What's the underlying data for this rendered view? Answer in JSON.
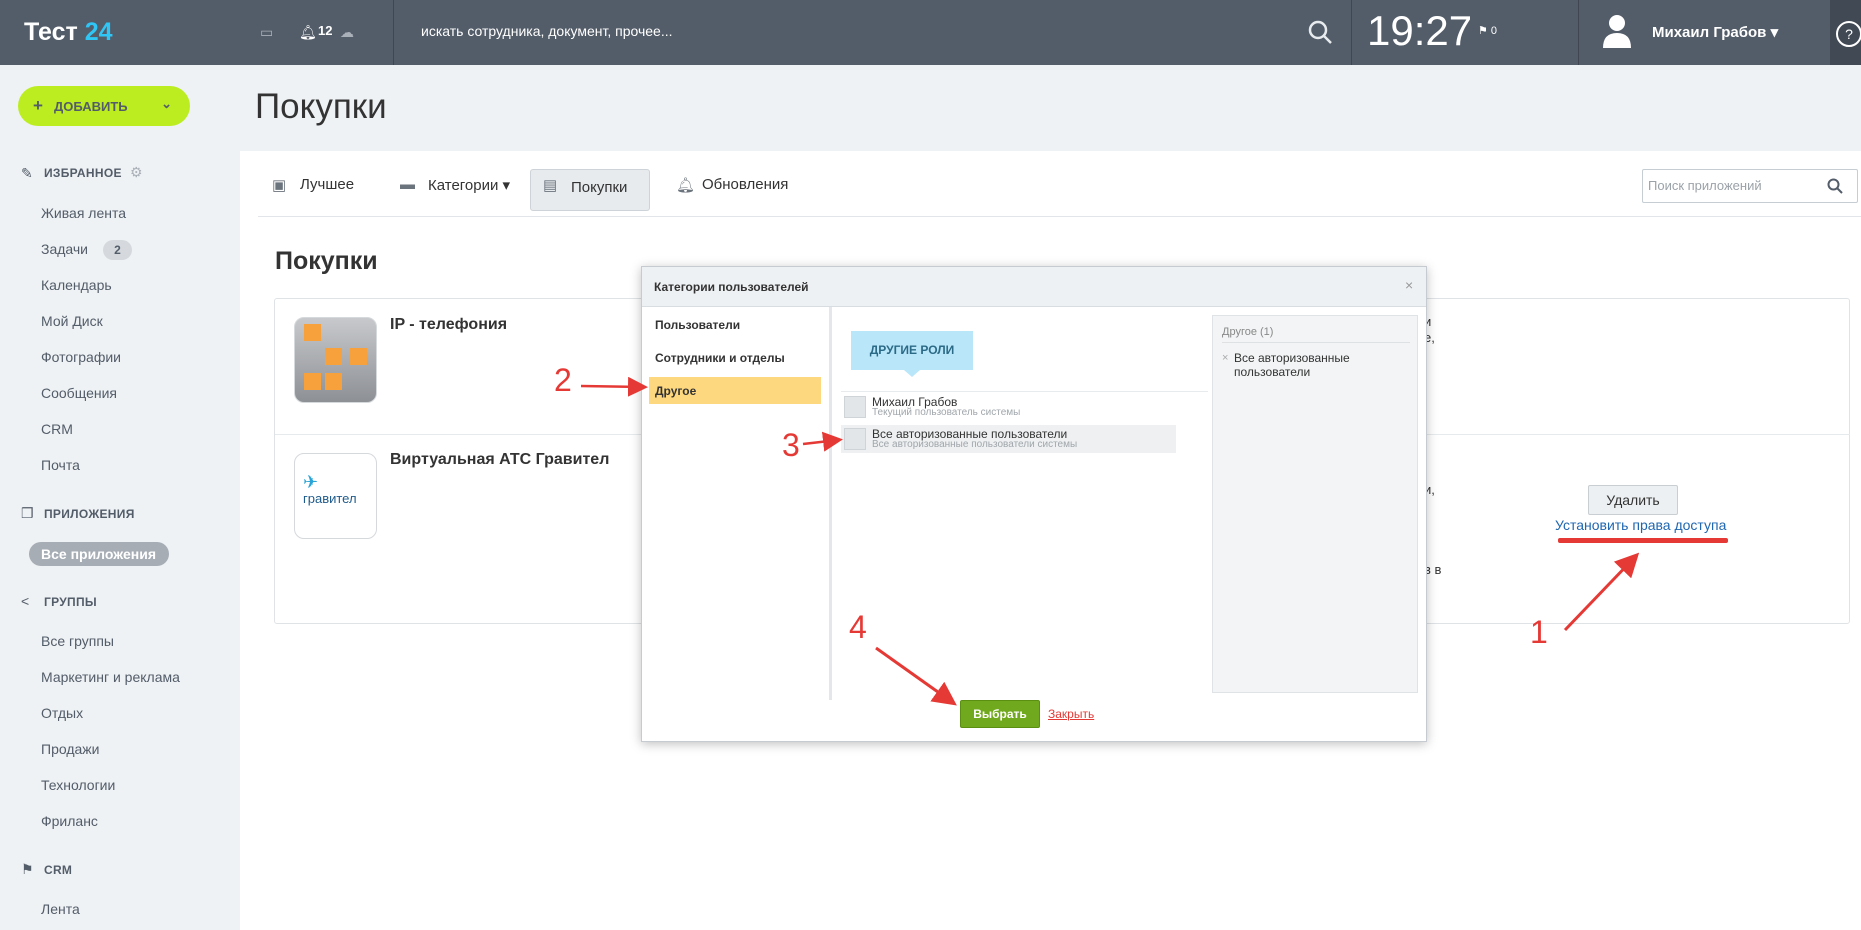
{
  "header": {
    "logo_text": "Тест ",
    "logo_num": "24",
    "notif_count": "12",
    "search_placeholder": "искать сотрудника, документ, прочее...",
    "clock": "19:27",
    "flag_count": "0",
    "user_name": "Михаил Грабов ▾",
    "help": "?"
  },
  "sidebar": {
    "add_label": "ДОБАВИТЬ",
    "favorites_title": "ИЗБРАННОЕ",
    "favorites": [
      "Живая лента",
      "Задачи",
      "Календарь",
      "Мой Диск",
      "Фотографии",
      "Сообщения",
      "CRM",
      "Почта"
    ],
    "tasks_badge": "2",
    "apps_title": "ПРИЛОЖЕНИЯ",
    "apps_active": "Все приложения",
    "groups_title": "ГРУППЫ",
    "groups": [
      "Все группы",
      "Маркетинг и реклама",
      "Отдых",
      "Продажи",
      "Технологии",
      "Фриланс"
    ],
    "crm_title": "CRM",
    "crm_items": [
      "Лента"
    ]
  },
  "page": {
    "title": "Покупки",
    "section_title": "Покупки",
    "tabs": [
      "Лучшее",
      "Категории ▾",
      "Покупки",
      "Обновления"
    ],
    "app_search_placeholder": "Поиск приложений"
  },
  "apps": [
    {
      "name": "IP - телефония",
      "fragments": [
        "и",
        "е,"
      ]
    },
    {
      "name": "Виртуальная АТС Гравител",
      "logo_text": "гравител",
      "fragments": [
        "и,",
        "в в"
      ],
      "delete_label": "Удалить",
      "access_link": "Установить права доступа"
    }
  ],
  "dialog": {
    "title": "Категории пользователей",
    "close": "×",
    "tabs": [
      "Пользователи",
      "Сотрудники и отделы",
      "Другое"
    ],
    "roles_button": "ДРУГИЕ РОЛИ",
    "users": [
      {
        "name": "Михаил Грабов",
        "sub": "Текущий пользователь системы"
      },
      {
        "name": "Все авторизованные пользователи",
        "sub": "Все авторизованные пользователи системы"
      }
    ],
    "selected_title": "Другое (1)",
    "selected_x": "×",
    "selected_item": "Все авторизованные пользователи",
    "choose_label": "Выбрать",
    "close_label": "Закрыть"
  },
  "annotations": [
    "1",
    "2",
    "3",
    "4"
  ],
  "colors": {
    "topbar": "#535c69",
    "accent_green": "#bbed21",
    "highlight": "#fdd87f",
    "arrow_red": "#e53935",
    "link_blue": "#2067b0"
  }
}
